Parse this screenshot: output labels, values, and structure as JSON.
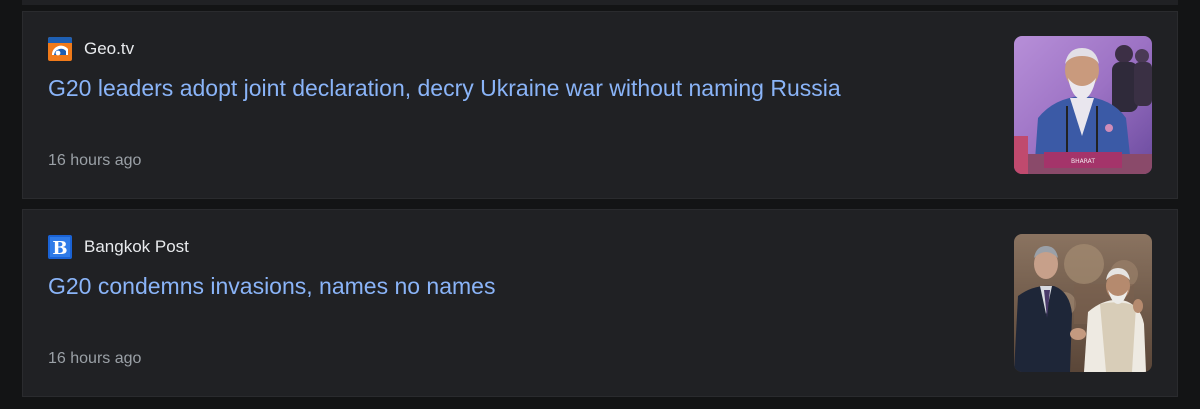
{
  "articles": [
    {
      "source": "Geo.tv",
      "source_icon": "geo-tv-logo-icon",
      "headline": "G20 leaders adopt joint declaration, decry Ukraine war without naming Russia",
      "time": "16 hours ago",
      "thumbnail": "modi-at-podium-image",
      "thumbnail_placard": "BHARAT"
    },
    {
      "source": "Bangkok Post",
      "source_icon": "bangkok-post-logo-icon",
      "headline": "G20 condemns invasions, names no names",
      "time": "16 hours ago",
      "thumbnail": "leaders-handshake-image"
    }
  ],
  "colors": {
    "page_bg": "#131415",
    "card_bg": "#202124",
    "headline": "#8ab4f8",
    "source_text": "#e8eaed",
    "time_text": "#9aa0a6"
  }
}
